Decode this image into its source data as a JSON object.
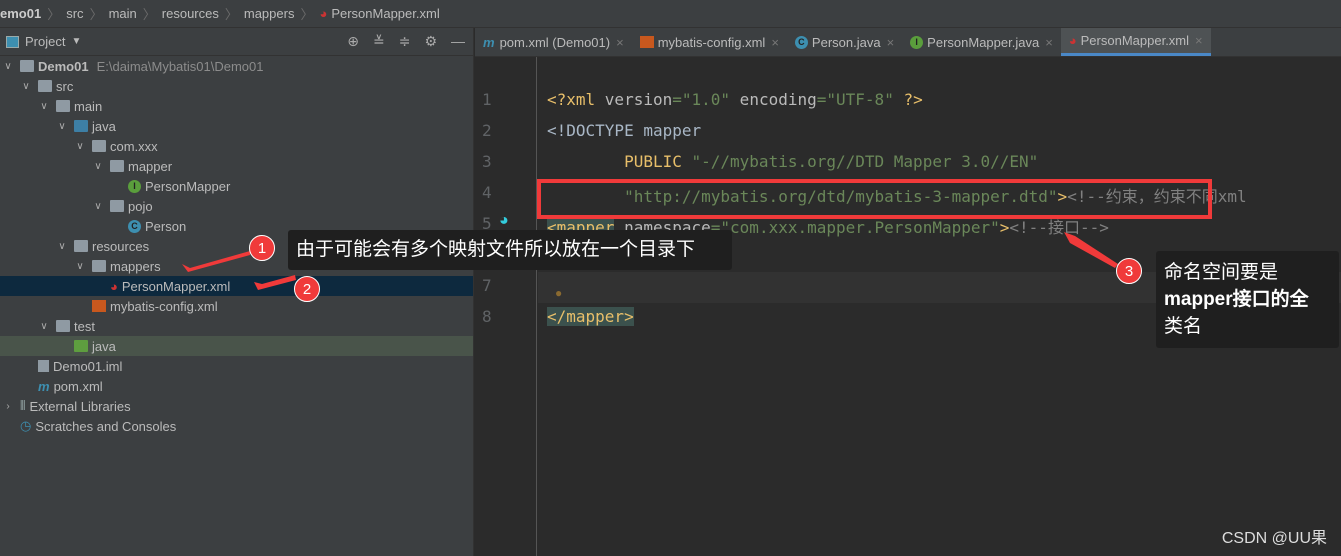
{
  "breadcrumb": [
    "emo01",
    "src",
    "main",
    "resources",
    "mappers",
    "PersonMapper.xml"
  ],
  "project_panel": {
    "title": "Project",
    "tools": [
      "locate-icon",
      "expand-all-icon",
      "collapse-all-icon",
      "gear-icon",
      "minimize-icon"
    ]
  },
  "tree": [
    {
      "label": "Demo01",
      "path": "E:\\daima\\Mybatis01\\Demo01"
    },
    {
      "label": "src"
    },
    {
      "label": "main"
    },
    {
      "label": "java"
    },
    {
      "label": "com.xxx"
    },
    {
      "label": "mapper"
    },
    {
      "label": "PersonMapper",
      "badge": "I"
    },
    {
      "label": "pojo"
    },
    {
      "label": "Person",
      "badge": "C"
    },
    {
      "label": "resources"
    },
    {
      "label": "mappers"
    },
    {
      "label": "PersonMapper.xml"
    },
    {
      "label": "mybatis-config.xml"
    },
    {
      "label": "test"
    },
    {
      "label": "java"
    },
    {
      "label": "Demo01.iml"
    },
    {
      "label": "pom.xml"
    },
    {
      "label": "External Libraries"
    },
    {
      "label": "Scratches and Consoles"
    }
  ],
  "tabs": [
    {
      "label": "pom.xml (Demo01)"
    },
    {
      "label": "mybatis-config.xml"
    },
    {
      "label": "Person.java",
      "badge": "C"
    },
    {
      "label": "PersonMapper.java",
      "badge": "I"
    },
    {
      "label": "PersonMapper.xml",
      "active": true
    }
  ],
  "editor": {
    "line_numbers": [
      "1",
      "2",
      "3",
      "4",
      "5",
      "6",
      "7",
      "8"
    ],
    "l1": [
      "<?",
      "xml ",
      "version",
      "=",
      "\"1.0\"",
      " encoding",
      "=",
      "\"UTF-8\"",
      " ?>"
    ],
    "l2": [
      "<!DOCTYPE ",
      "mapper"
    ],
    "l3": [
      "        PUBLIC ",
      "\"-//mybatis.org//DTD Mapper 3.0//EN\""
    ],
    "l4": [
      "        ",
      "\"http://mybatis.org/dtd/mybatis-3-mapper.dtd\"",
      ">",
      "<!--约束，约束不同xml"
    ],
    "l5": [
      "<mapper",
      " namespace",
      "=",
      "\"com.xxx.mapper.PersonMapper\"",
      ">",
      "<!--接口-->"
    ],
    "l8": [
      "</mapper",
      ">"
    ]
  },
  "annotations": {
    "n1": "1",
    "n2": "2",
    "n3": "3",
    "callout1": "由于可能会有多个映射文件所以放在一个目录下",
    "callout3": [
      "命名空间要是",
      "mapper接口的全",
      "类名"
    ]
  },
  "watermark": "CSDN @UU果",
  "colors": {
    "accent": "#4a88c7",
    "annotation_red": "#f03a3a"
  }
}
